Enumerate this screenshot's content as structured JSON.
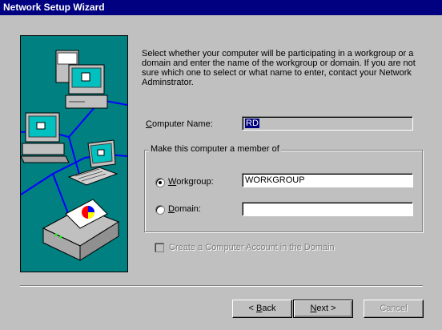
{
  "window": {
    "title": "Network Setup Wizard"
  },
  "description": "Select whether your computer will be participating in a workgroup or a domain and enter the name of the workgroup or domain.  If you are not sure which one to select or what name to enter, contact your Network Adminstrator.",
  "computer_name": {
    "label_mnemonic": "C",
    "label_rest": "omputer Name:",
    "value": "RD"
  },
  "member_group": {
    "legend": "Make this computer a member of",
    "workgroup": {
      "label_mnemonic": "W",
      "label_rest": "orkgroup:",
      "value": "WORKGROUP",
      "selected": true
    },
    "domain": {
      "label_mnemonic": "D",
      "label_rest": "omain:",
      "value": "",
      "selected": false
    }
  },
  "create_account": {
    "label": "Create a Computer Account in the Domain",
    "checked": false,
    "enabled": false
  },
  "buttons": {
    "back": {
      "mnemonic": "B",
      "rest": "ack",
      "prefix": "< "
    },
    "next": {
      "mnemonic": "N",
      "rest": "ext >"
    },
    "cancel": {
      "label": "Cancel"
    }
  },
  "colors": {
    "title_bar": "#000080",
    "art_background": "#008080",
    "dialog_face": "#c0c0c0"
  },
  "icons": [
    "server-computer-icon",
    "desktop-computer-icon",
    "laptop-icon",
    "printer-icon"
  ]
}
